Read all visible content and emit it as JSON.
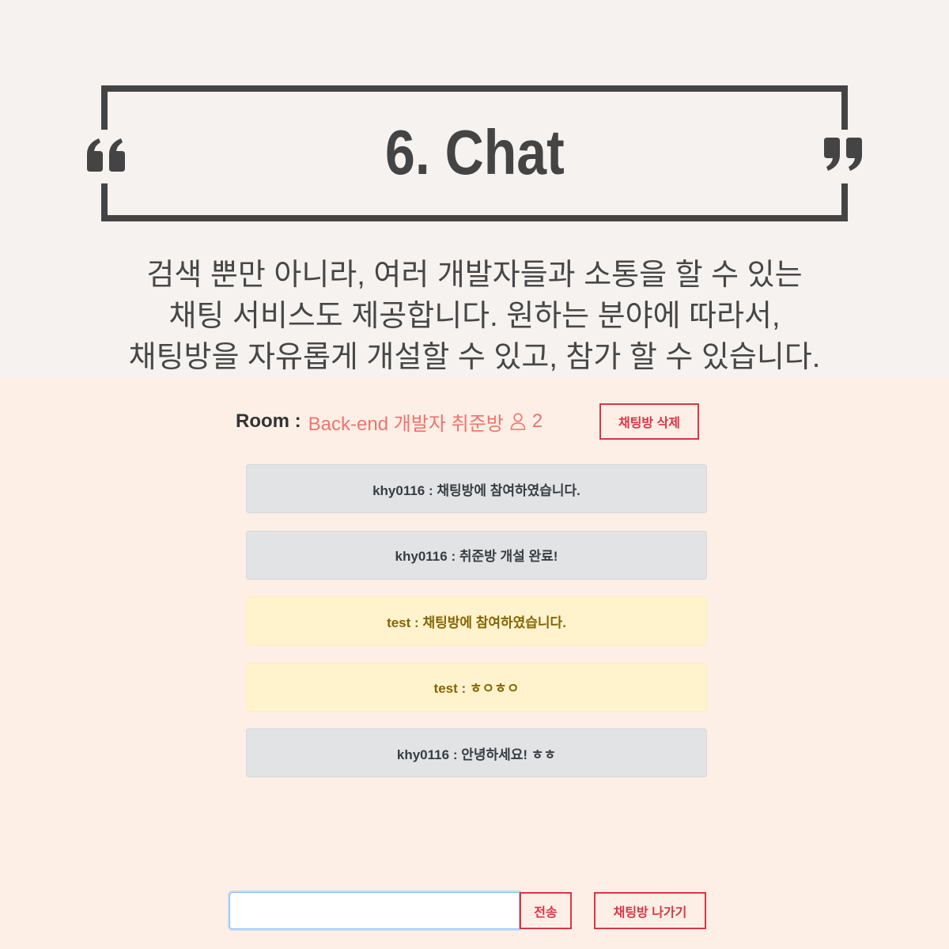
{
  "header": {
    "title": "6. Chat",
    "description_lines": [
      "검색 뿐만 아니라, 여러 개발자들과 소통을 할 수 있는",
      "채팅 서비스도 제공합니다. 원하는 분야에 따라서,",
      "채팅방을 자유롭게 개설할 수 있고, 참가 할 수 있습니다."
    ],
    "icons": {
      "open_quote": "open-quote-icon",
      "close_quote": "close-quote-icon"
    }
  },
  "room": {
    "label": "Room :",
    "name": "Back-end 개발자 취준방",
    "member_icon": "user-icon",
    "member_count": "2",
    "delete_button_label": "채팅방 삭제"
  },
  "chat": {
    "separator": ":",
    "messages": [
      {
        "sender": "khy0116",
        "text": "채팅방에 참여하였습니다.",
        "bg": "#e2e3e5",
        "border": "#d6d8db",
        "color": "#383d41"
      },
      {
        "sender": "khy0116",
        "text": "취준방 개설 완료!",
        "bg": "#e2e3e5",
        "border": "#d6d8db",
        "color": "#383d41"
      },
      {
        "sender": "test",
        "text": "채팅방에 참여하였습니다.",
        "bg": "#fff3cd",
        "border": "#ffeeba",
        "color": "#856404"
      },
      {
        "sender": "test",
        "text": "ㅎㅇㅎㅇ",
        "bg": "#fff3cd",
        "border": "#ffeeba",
        "color": "#856404"
      },
      {
        "sender": "khy0116",
        "text": "안녕하세요! ㅎㅎ",
        "bg": "#e2e3e5",
        "border": "#d6d8db",
        "color": "#383d41"
      }
    ]
  },
  "composer": {
    "input_value": "",
    "input_placeholder": "",
    "send_button_label": "전송",
    "leave_button_label": "채팅방 나가기"
  },
  "colors": {
    "frame": "#444444",
    "room_name": "#f0736d",
    "danger": "#dc3545",
    "top_background": "#f5f2f0",
    "chat_background": "#fdefe6"
  }
}
